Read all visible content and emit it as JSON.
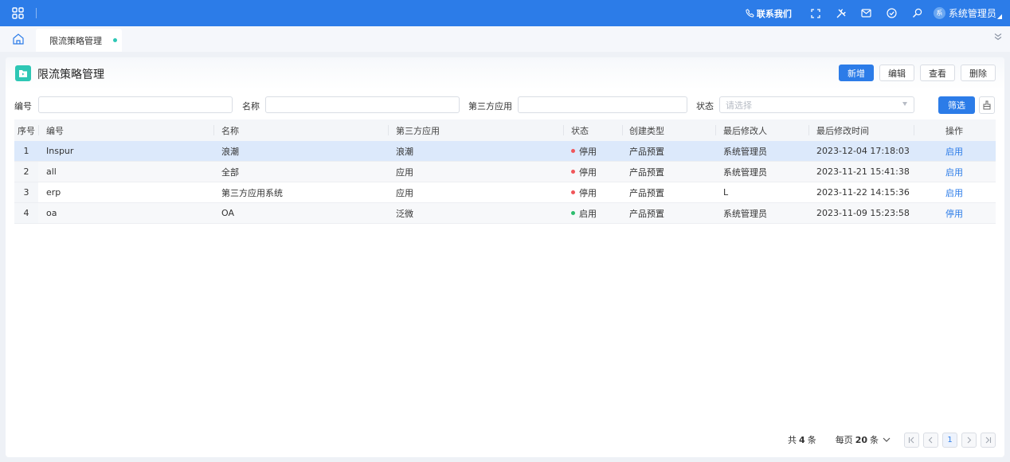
{
  "topbar": {
    "contact_label": "联系我们",
    "user_name": "系统管理员",
    "user_avatar_char": "系"
  },
  "tabs": [
    {
      "label": "限流策略管理",
      "active": true
    }
  ],
  "page": {
    "title": "限流策略管理",
    "actions": {
      "add": "新增",
      "edit": "编辑",
      "view": "查看",
      "delete": "删除"
    }
  },
  "filters": {
    "code_label": "编号",
    "code_value": "",
    "name_label": "名称",
    "name_value": "",
    "app_label": "第三方应用",
    "app_value": "",
    "status_label": "状态",
    "status_placeholder": "请选择",
    "filter_button": "筛选"
  },
  "table": {
    "headers": {
      "index": "序号",
      "code": "编号",
      "name": "名称",
      "app": "第三方应用",
      "status": "状态",
      "create_type": "创建类型",
      "modifier": "最后修改人",
      "modified_time": "最后修改时间",
      "operation": "操作"
    },
    "rows": [
      {
        "index": "1",
        "code": "Inspur",
        "name": "浪潮",
        "app": "浪潮",
        "status": "停用",
        "create_type": "产品预置",
        "modifier": "系统管理员",
        "modified_time": "2023-12-04 17:18:03",
        "operation": "启用"
      },
      {
        "index": "2",
        "code": "all",
        "name": "全部",
        "app": "应用",
        "status": "停用",
        "create_type": "产品预置",
        "modifier": "系统管理员",
        "modified_time": "2023-11-21 15:41:38",
        "operation": "启用"
      },
      {
        "index": "3",
        "code": "erp",
        "name": "第三方应用系统",
        "app": "应用",
        "status": "停用",
        "create_type": "产品预置",
        "modifier": "L",
        "modified_time": "2023-11-22 14:15:36",
        "operation": "启用"
      },
      {
        "index": "4",
        "code": "oa",
        "name": "OA",
        "app": "泛微",
        "status": "启用",
        "create_type": "产品预置",
        "modifier": "系统管理员",
        "modified_time": "2023-11-09 15:23:58",
        "operation": "停用"
      }
    ]
  },
  "pagination": {
    "total_prefix": "共",
    "total": "4",
    "total_suffix": "条",
    "size_prefix": "每页",
    "page_size": "20",
    "size_suffix": "条",
    "current_page": "1"
  },
  "colors": {
    "primary": "#2c7ce8",
    "status_disabled": "#f0565a",
    "status_enabled": "#2dbd6e",
    "accent_teal": "#2ec7b5"
  }
}
